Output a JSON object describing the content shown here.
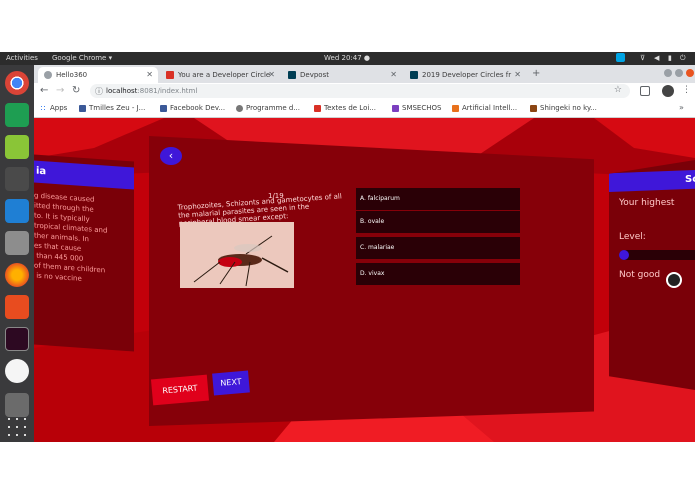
{
  "topbar": {
    "activities": "Activities",
    "app_menu": "Google Chrome ▾",
    "clock": "Wed 20:47 ●",
    "tray_icons": [
      "skype-icon",
      "network-icon",
      "volume-icon",
      "battery-icon",
      "power-icon"
    ]
  },
  "dock": {
    "apps": [
      "chrome-icon",
      "spreadsheet-icon",
      "cube-icon",
      "scanner-icon",
      "vscode-icon",
      "files-icon",
      "firefox-icon",
      "software-center-icon",
      "terminal-icon",
      "sound-icon",
      "usb-icon",
      "show-apps-icon"
    ]
  },
  "browser": {
    "tabs": [
      {
        "title": "Hello360",
        "active": true
      },
      {
        "title": "You are a Developer Circle",
        "active": false
      },
      {
        "title": "Devpost",
        "active": false
      },
      {
        "title": "2019 Developer Circles fr",
        "active": false
      }
    ],
    "new_tab": "+",
    "url_host": "localhost",
    "url_rest": ":8081/index.html",
    "bookmarks": [
      {
        "label": "Apps"
      },
      {
        "label": "Tmilles Zeu - J..."
      },
      {
        "label": "Facebook Dev..."
      },
      {
        "label": "Programme d..."
      },
      {
        "label": "Textes de Loi..."
      },
      {
        "label": "SMSECHOS"
      },
      {
        "label": "Artificial Intell..."
      },
      {
        "label": "Shingeki no ky..."
      }
    ],
    "more": "»"
  },
  "colors": {
    "accent": "#3f17d9",
    "scene_red": "#c2000a",
    "panel_dark": "#7a0008",
    "restart": "#e0001b"
  },
  "left_panel": {
    "title": "ia",
    "body": "g disease caused\nitted through the\nto. It is typically\ntropical climates and\nther animals. In\nes that cause\n than 445 000\nof them are children\n is no vaccine"
  },
  "quiz": {
    "progress": "1/19",
    "question": "Trophozoites, Schizonts and gametocytes of all the malarial parasites are seen in the peripheral blood smear except:",
    "image": "mosquito-image",
    "answers": [
      "A. falciparum",
      "B. ovale",
      "C. malariae",
      "D. vivax"
    ],
    "restart": "RESTART",
    "next": "NEXT"
  },
  "right_panel": {
    "title": "Sc",
    "highest": "Your highest",
    "level": "Level:",
    "rating": "Not good",
    "level_value": 0.02
  }
}
